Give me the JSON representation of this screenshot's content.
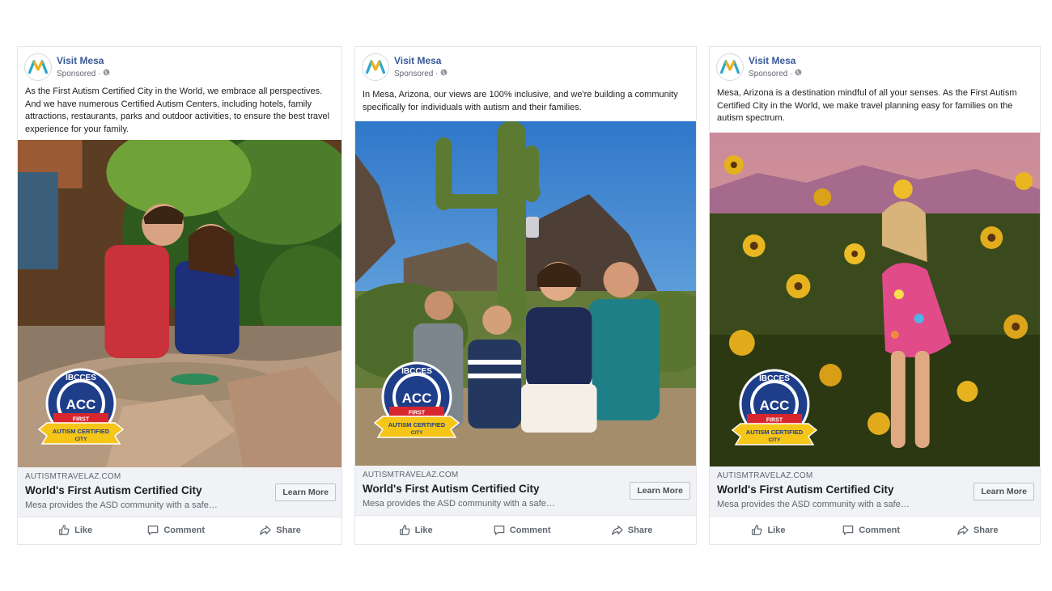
{
  "brand": {
    "link_color": "#385898",
    "logo_colors": [
      "#2aa8c9",
      "#f2b21c"
    ]
  },
  "ads": [
    {
      "page_name": "Visit Mesa",
      "sponsored_label": "Sponsored ·",
      "post_text": "As the First Autism Certified City in the World, we embrace all perspectives. And we have numerous Certified Autism Centers, including hotels, family attractions, restaurants, parks and outdoor activities, to ensure the best travel experience for your family.",
      "image_icon": "photo-mother-and-son-gem-mining",
      "link_domain": "AUTISMTRAVELAZ.COM",
      "link_title": "World's First Autism Certified City",
      "link_description": "Mesa provides the ASD community with a safe…",
      "cta_label": "Learn More"
    },
    {
      "page_name": "Visit Mesa",
      "sponsored_label": "Sponsored ·",
      "post_text": "In Mesa, Arizona, our views are 100% inclusive, and we're building a community specifically for individuals with autism and their families.",
      "image_icon": "photo-family-selfie-desert-cactus",
      "link_domain": "AUTISMTRAVELAZ.COM",
      "link_title": "World's First Autism Certified City",
      "link_description": "Mesa provides the ASD community with a safe…",
      "cta_label": "Learn More"
    },
    {
      "page_name": "Visit Mesa",
      "sponsored_label": "Sponsored ·",
      "post_text": "Mesa, Arizona is a destination mindful of all your senses. As the First Autism Certified City in the World, we make travel planning easy for families on the autism spectrum.",
      "image_icon": "photo-girl-in-sunflower-field",
      "link_domain": "AUTISMTRAVELAZ.COM",
      "link_title": "World's First Autism Certified City",
      "link_description": "Mesa provides the ASD community with a safe…",
      "cta_label": "Learn More"
    }
  ],
  "badge": {
    "top_text": "IBCCES",
    "center_text": "ACC",
    "ribbon_text": "FIRST",
    "banner_text": "AUTISM CERTIFIED",
    "bottom_text": "CITY",
    "colors": {
      "navy": "#1f3e8a",
      "red": "#d8262e",
      "gold": "#f5c518"
    }
  },
  "actions": {
    "like": "Like",
    "comment": "Comment",
    "share": "Share"
  }
}
